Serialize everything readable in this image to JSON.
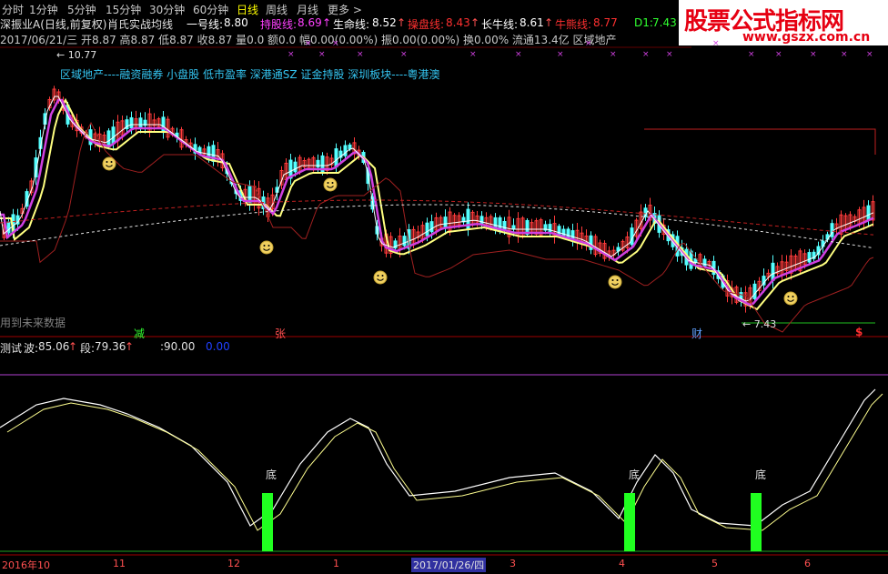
{
  "period_tabs": [
    "分时",
    "1分钟",
    "5分钟",
    "15分钟",
    "30分钟",
    "60分钟",
    "日线",
    "周线",
    "月线",
    "更多 >"
  ],
  "active_tab": "日线",
  "title_row": {
    "stock": "深振业A(日线,前复权)",
    "indicator": "肖氏实战均线",
    "ma": [
      {
        "label": "一号线:",
        "value": "8.80",
        "color": "#ffffff",
        "arrow": ""
      },
      {
        "label": "持股线:",
        "value": "8.69",
        "color": "#ff40ff",
        "arrow": "↑"
      },
      {
        "label": "生命线:",
        "value": "8.52",
        "color": "#ffffff",
        "arrow": "↑"
      },
      {
        "label": "操盘线:",
        "value": "8.43",
        "color": "#ff3030",
        "arrow": "↑"
      },
      {
        "label": "长牛线:",
        "value": "8.61",
        "color": "#ffffff",
        "arrow": "↑"
      },
      {
        "label": "牛熊线:",
        "value": "8.77",
        "color": "#ff3030",
        "arrow": ""
      },
      {
        "label": "D1:",
        "value": "7.43",
        "color": "#30ff30",
        "arrow": ""
      }
    ]
  },
  "info_row": "2017/06/21/三 开8.87 高8.87 低8.87 收8.87 量0.0 额0.0 幅0.00(0.00%) 振0.00(0.00%) 换0.00% 流通13.4亿 区域地产",
  "sectors": "区域地产----融资融券 小盘股 低市盈率 深港通SZ 证金持股 深圳板块----粤港澳",
  "high_label": "10.77",
  "low_label": "7.43",
  "future_label": "用到未来数据",
  "markers": [
    {
      "text": "减",
      "color": "#30ff30"
    },
    {
      "text": "张",
      "color": "#ff5050"
    },
    {
      "text": "财",
      "color": "#5fa0ff"
    },
    {
      "text": "$",
      "color": "#ff3030"
    }
  ],
  "osc_row": {
    "name": "测试",
    "wave_label": "波:",
    "wave": "85.06",
    "seg_label": "段:",
    "seg": "79.36",
    "line90": ":90.00",
    "line0": "0.00"
  },
  "bottom_labels": [
    "底",
    "底",
    "底"
  ],
  "dates": [
    "2016年10",
    "11",
    "12",
    "1",
    "2017/01/26/四",
    "3",
    "4",
    "5",
    "6"
  ],
  "logo": {
    "title": "股票公式指标网",
    "url": "www.gszx.com.cn"
  },
  "colors": {
    "up": "#ff3b3b",
    "down": "#54ffff",
    "ma_yellow": "#ffff80",
    "ma_magenta": "#d040e0",
    "signal": "#20ff20"
  }
}
